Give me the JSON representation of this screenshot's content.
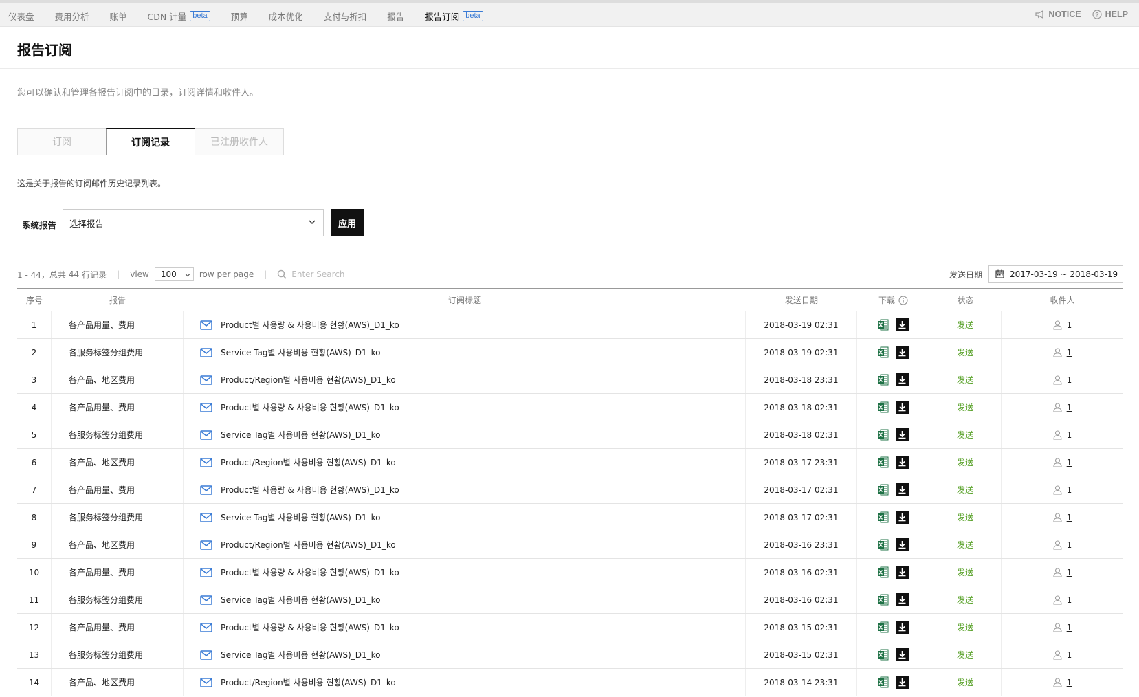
{
  "nav": {
    "items": [
      {
        "label": "仪表盘"
      },
      {
        "label": "费用分析"
      },
      {
        "label": "账单"
      },
      {
        "label": "CDN 计量",
        "badge": "beta"
      },
      {
        "label": "预算"
      },
      {
        "label": "成本优化"
      },
      {
        "label": "支付与折扣"
      },
      {
        "label": "报告"
      },
      {
        "label": "报告订阅",
        "badge": "beta",
        "active": true
      }
    ],
    "notice": "NOTICE",
    "help": "HELP"
  },
  "page": {
    "title": "报告订阅",
    "description": "您可以确认和管理各报告订阅中的目录，订阅详情和收件人。"
  },
  "tabs": [
    {
      "label": "订阅"
    },
    {
      "label": "订阅记录",
      "active": true
    },
    {
      "label": "已注册收件人"
    }
  ],
  "subdesc": "这是关于报告的订阅邮件历史记录列表。",
  "filter": {
    "label": "系统报告",
    "select_value": "选择报告",
    "apply": "应用"
  },
  "controls": {
    "range": "1 - 44，",
    "total_prefix": "总共",
    "total": "44",
    "total_suffix": "行记录",
    "view": "view",
    "rows": "100",
    "rows_suffix": "row per page",
    "search_placeholder": "Enter Search",
    "date_label": "发送日期",
    "date_range": "2017-03-19 ~ 2018-03-19"
  },
  "table": {
    "headers": {
      "no": "序号",
      "report": "报告",
      "subject": "订阅标题",
      "date": "发送日期",
      "download": "下载",
      "status": "状态",
      "recipients": "收件人"
    },
    "rows": [
      {
        "no": "1",
        "report": "各产品用量、费用",
        "subject": "Product별 사용량 & 사용비용 현황(AWS)_D1_ko",
        "date": "2018-03-19 02:31",
        "status": "发送",
        "recipients": "1"
      },
      {
        "no": "2",
        "report": "各服务标签分组费用",
        "subject": "Service Tag별 사용비용 현황(AWS)_D1_ko",
        "date": "2018-03-19 02:31",
        "status": "发送",
        "recipients": "1"
      },
      {
        "no": "3",
        "report": "各产品、地区费用",
        "subject": "Product/Region별 사용비용 현황(AWS)_D1_ko",
        "date": "2018-03-18 23:31",
        "status": "发送",
        "recipients": "1"
      },
      {
        "no": "4",
        "report": "各产品用量、费用",
        "subject": "Product별 사용량 & 사용비용 현황(AWS)_D1_ko",
        "date": "2018-03-18 02:31",
        "status": "发送",
        "recipients": "1"
      },
      {
        "no": "5",
        "report": "各服务标签分组费用",
        "subject": "Service Tag별 사용비용 현황(AWS)_D1_ko",
        "date": "2018-03-18 02:31",
        "status": "发送",
        "recipients": "1"
      },
      {
        "no": "6",
        "report": "各产品、地区费用",
        "subject": "Product/Region별 사용비용 현황(AWS)_D1_ko",
        "date": "2018-03-17 23:31",
        "status": "发送",
        "recipients": "1"
      },
      {
        "no": "7",
        "report": "各产品用量、费用",
        "subject": "Product별 사용량 & 사용비용 현황(AWS)_D1_ko",
        "date": "2018-03-17 02:31",
        "status": "发送",
        "recipients": "1"
      },
      {
        "no": "8",
        "report": "各服务标签分组费用",
        "subject": "Service Tag별 사용비용 현황(AWS)_D1_ko",
        "date": "2018-03-17 02:31",
        "status": "发送",
        "recipients": "1"
      },
      {
        "no": "9",
        "report": "各产品、地区费用",
        "subject": "Product/Region별 사용비용 현황(AWS)_D1_ko",
        "date": "2018-03-16 23:31",
        "status": "发送",
        "recipients": "1"
      },
      {
        "no": "10",
        "report": "各产品用量、费用",
        "subject": "Product별 사용량 & 사용비용 현황(AWS)_D1_ko",
        "date": "2018-03-16 02:31",
        "status": "发送",
        "recipients": "1"
      },
      {
        "no": "11",
        "report": "各服务标签分组费用",
        "subject": "Service Tag별 사용비용 현황(AWS)_D1_ko",
        "date": "2018-03-16 02:31",
        "status": "发送",
        "recipients": "1"
      },
      {
        "no": "12",
        "report": "各产品用量、费用",
        "subject": "Product별 사용량 & 사용비용 현황(AWS)_D1_ko",
        "date": "2018-03-15 02:31",
        "status": "发送",
        "recipients": "1"
      },
      {
        "no": "13",
        "report": "各服务标签分组费用",
        "subject": "Service Tag별 사용비용 현황(AWS)_D1_ko",
        "date": "2018-03-15 02:31",
        "status": "发送",
        "recipients": "1"
      },
      {
        "no": "14",
        "report": "各产品、地区费用",
        "subject": "Product/Region별 사용비용 현황(AWS)_D1_ko",
        "date": "2018-03-14 23:31",
        "status": "发送",
        "recipients": "1"
      }
    ]
  },
  "colors": {
    "accent_blue": "#3a7bd5",
    "status_green": "#5ba32c",
    "excel_green": "#1e7145"
  },
  "icons": {
    "notice": "megaphone-icon",
    "help": "question-icon",
    "mail": "mail-icon",
    "excel": "excel-icon",
    "download": "download-icon",
    "recipient": "user-icon",
    "calendar": "calendar-icon",
    "search": "search-icon"
  }
}
